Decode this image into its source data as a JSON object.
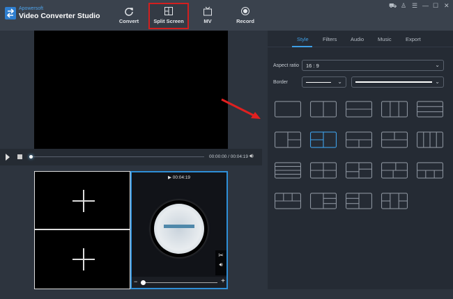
{
  "app": {
    "brand": "Apowersoft",
    "title": "Video Converter Studio"
  },
  "nav": [
    {
      "label": "Convert",
      "icon": "refresh-icon"
    },
    {
      "label": "Split Screen",
      "icon": "split-screen-icon",
      "active": true
    },
    {
      "label": "MV",
      "icon": "tv-icon"
    },
    {
      "label": "Record",
      "icon": "record-icon"
    }
  ],
  "window_controls": [
    "cart-icon",
    "user-icon",
    "menu-icon",
    "minimize-icon",
    "maximize-icon",
    "close-icon"
  ],
  "player": {
    "time": "00:00:00 / 00:04:19",
    "progress": 0
  },
  "clip": {
    "duration": "00:04:19",
    "zoom": 0.1
  },
  "panel": {
    "tabs": [
      "Style",
      "Filters",
      "Audio",
      "Music",
      "Export"
    ],
    "active_tab": "Style",
    "aspect_label": "Aspect ratio",
    "aspect_value": "16 : 9",
    "border_label": "Border",
    "selected_layout": 6,
    "accent": "#3fa0e8"
  }
}
